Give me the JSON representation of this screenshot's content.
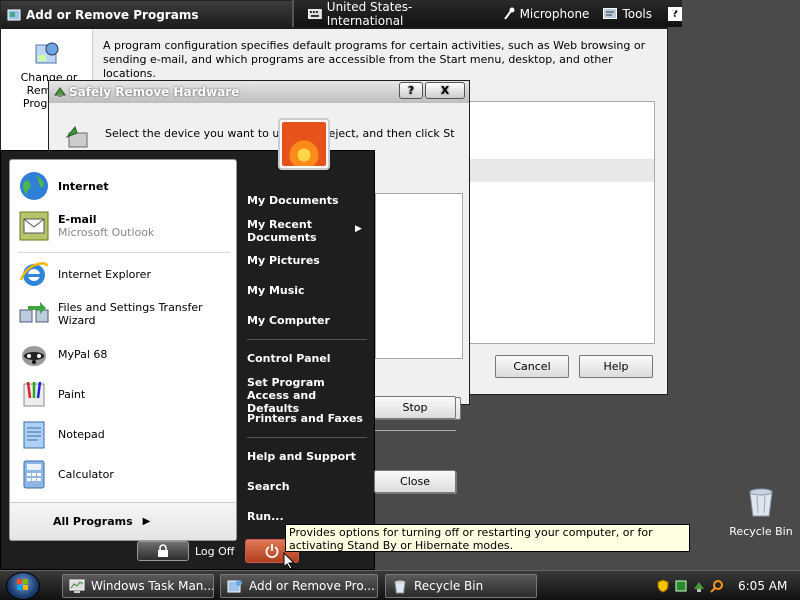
{
  "arp_window": {
    "title": "Add or Remove Programs",
    "sidebar_label": "Change or Remove Programs",
    "description": "A program configuration specifies default programs for certain activities, such as Web browsing or sending e-mail, and which programs are accessible from the Start menu, desktop, and other locations.",
    "cancel_label": "Cancel",
    "help_label": "Help"
  },
  "langbar": {
    "language": "United States-International",
    "microphone": "Microphone",
    "tools": "Tools",
    "help": "?"
  },
  "srh_dialog": {
    "title": "Safely Remove Hardware",
    "help_btn": "?",
    "close_btn": "X",
    "instructions": "Select the device you want to unplug or eject, and then click Stop. When Windows notifies you that it is safe to do so unplug the device from your",
    "stop_label": "Stop",
    "close_label": "Close"
  },
  "start_menu": {
    "pinned": [
      {
        "label": "Internet",
        "icon": "globe-icon"
      },
      {
        "label": "E-mail",
        "sub": "Microsoft Outlook",
        "icon": "email-icon"
      }
    ],
    "recent": [
      {
        "label": "Internet Explorer",
        "icon": "internet-explorer-icon"
      },
      {
        "label": "Files and Settings Transfer Wizard",
        "icon": "transfer-wizard-icon"
      },
      {
        "label": "MyPal 68",
        "icon": "raccoon-icon"
      },
      {
        "label": "Paint",
        "icon": "paint-icon"
      },
      {
        "label": "Notepad",
        "icon": "notepad-icon"
      },
      {
        "label": "Calculator",
        "icon": "calculator-icon"
      }
    ],
    "all_programs": "All Programs",
    "right_items": [
      "My Documents",
      "My Recent Documents",
      "My Pictures",
      "My Music",
      "My Computer",
      "Control Panel",
      "Set Program Access and Defaults",
      "Printers and Faxes",
      "Help and Support",
      "Search",
      "Run..."
    ],
    "log_off": "Log Off"
  },
  "tooltip": {
    "text": "Provides options for turning off or restarting your computer, or for activating Stand By or Hibernate modes."
  },
  "desktop": {
    "recycle_bin": "Recycle Bin"
  },
  "taskbar": {
    "buttons": [
      {
        "label": "Windows Task Man...",
        "icon": "task-manager-icon"
      },
      {
        "label": "Add or Remove Pro...",
        "icon": "add-remove-icon"
      },
      {
        "label": "Recycle Bin",
        "icon": "recycle-bin-icon"
      }
    ],
    "clock": "6:05 AM"
  },
  "colors": {
    "accent": "#ff8a1c",
    "taskbar": "#1a1a1a",
    "tooltip_bg": "#ffffe1"
  }
}
